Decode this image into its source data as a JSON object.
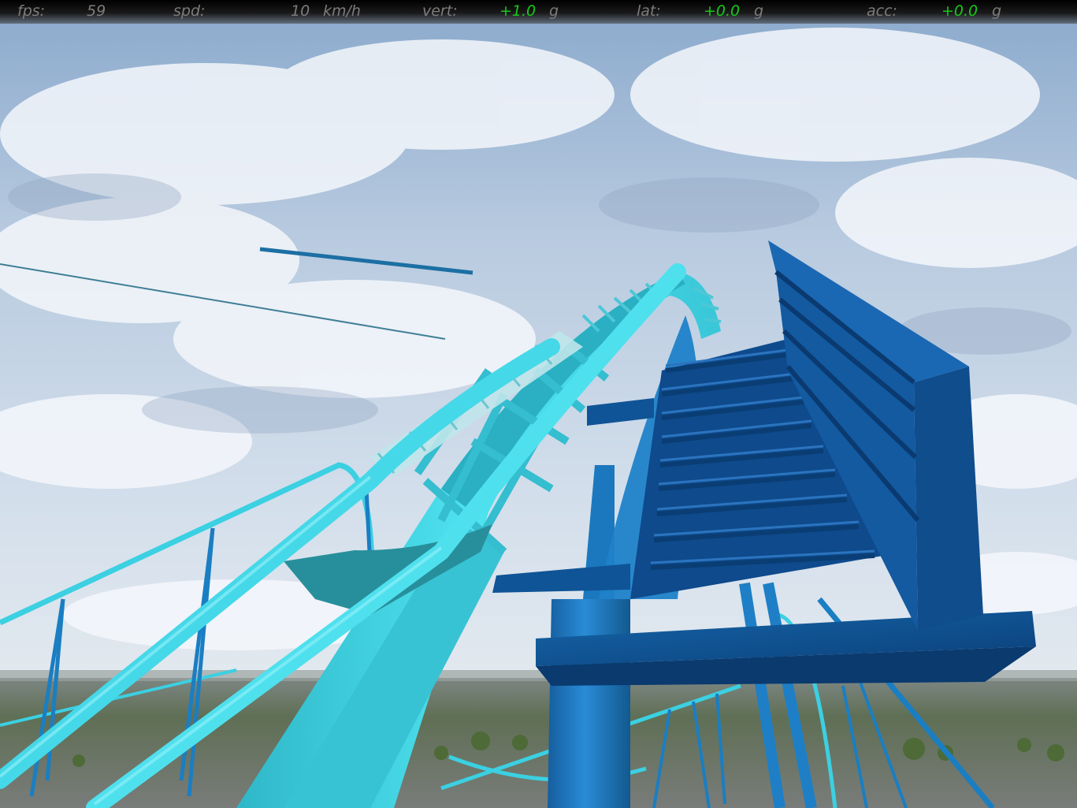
{
  "hud": {
    "fps_label": "fps:",
    "fps_value": "59",
    "spd_label": "spd:",
    "spd_value": "10",
    "spd_unit": "km/h",
    "vert_label": "vert:",
    "vert_value": "+1.0",
    "vert_unit": "g",
    "lat_label": "lat:",
    "lat_value": "+0.0",
    "lat_unit": "g",
    "acc_label": "acc:",
    "acc_value": "+0.0",
    "acc_unit": "g"
  },
  "colors": {
    "hud_label": "#7c7c7c",
    "hud_value_positive": "#16c916",
    "track_cyan": "#3fd6e6",
    "support_blue": "#1e7fc6",
    "platform_blue": "#0f4f93",
    "sky_top": "#8eaed0",
    "ground": "#6f7a6e"
  },
  "scene": {
    "view": "first-person coaster ride",
    "track_section": "lift hill crest",
    "structures": [
      "cyan-track-spine",
      "steel-supports",
      "wooden-catwalk-platform"
    ]
  }
}
